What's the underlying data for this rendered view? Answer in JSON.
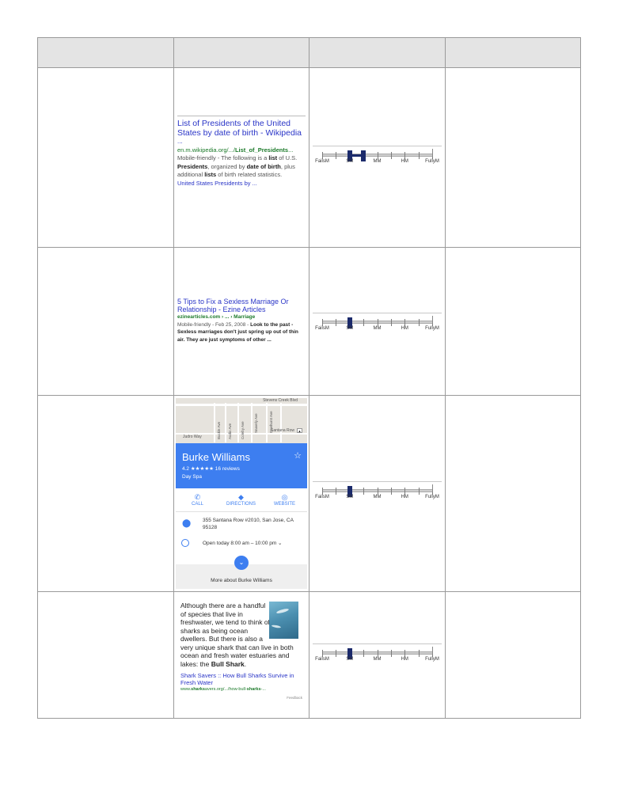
{
  "scale_labels": [
    "FailsM",
    "SM",
    "MM",
    "HM",
    "FullyM"
  ],
  "rows": [
    {
      "rating": {
        "from": 0.25,
        "to": 0.375
      },
      "result": {
        "title": "List of Presidents of the United States by date of birth - Wikipedia",
        "ellipsis": "...",
        "url": "en.m.wikipedia.org/.../List_of_Presidents...",
        "desc_pre": "Mobile-friendly - The following is a ",
        "desc_b1": "list",
        "desc_mid1": " of U.S. ",
        "desc_b2": "Presidents",
        "desc_mid2": ", organized by ",
        "desc_b3": "date of birth",
        "desc_mid3": ", plus additional ",
        "desc_b4": "lists",
        "desc_post": " of birth related statistics.",
        "sublink": "United States Presidents by ..."
      }
    },
    {
      "rating": {
        "from": 0.25,
        "to": 0.25
      },
      "result": {
        "title": "5 Tips to Fix a Sexless Marriage Or Relationship - Ezine Articles",
        "url": "ezinearticles.com › ... › Marriage",
        "desc_pre": "Mobile-friendly - Feb 25, 2008 - ",
        "desc_b": "Look to the past - Sexless marriages don't just spring up out of thin air. They are just symptoms of other ..."
      }
    },
    {
      "rating": {
        "from": 0.25,
        "to": 0.25
      },
      "result": {
        "map_labels": {
          "top": "Stevens Creek Blvd",
          "left": "Judro Way",
          "right": "Santana Row",
          "v1": "Buckle Ave",
          "v2": "Audio Ave",
          "v3": "Coleby Ave",
          "v4": "Snavely Ave",
          "v5": "Dewhurst Ave"
        },
        "name": "Burke Williams",
        "rating_text": "4.2 ★★★★★ 16 reviews",
        "type": "Day Spa",
        "actions": [
          {
            "label": "CALL",
            "icon": "phone-icon",
            "glyph": "✆"
          },
          {
            "label": "DIRECTIONS",
            "icon": "directions-icon",
            "glyph": "◆"
          },
          {
            "label": "WEBSITE",
            "icon": "globe-icon",
            "glyph": "◎"
          }
        ],
        "address": "355 Santana Row #2010, San Jose, CA 95128",
        "hours": "Open today 8:00 am – 10:00 pm ⌄",
        "more": "More about Burke Williams"
      }
    },
    {
      "rating": {
        "from": 0.25,
        "to": 0.25
      },
      "result": {
        "text_pre": "Although there are a handful of species that live in freshwater, we tend to think of sharks as being ocean dwellers. But there is also a very unique shark that can live in both ocean and fresh water estuaries and lakes: the ",
        "text_b": "Bull Shark",
        "text_post": ".",
        "source": "Shark Savers :: How Bull Sharks Survive in Fresh Water",
        "url": "www.sharksavers.org/.../how-bull-sharks-...",
        "feedback": "Feedback"
      }
    }
  ]
}
